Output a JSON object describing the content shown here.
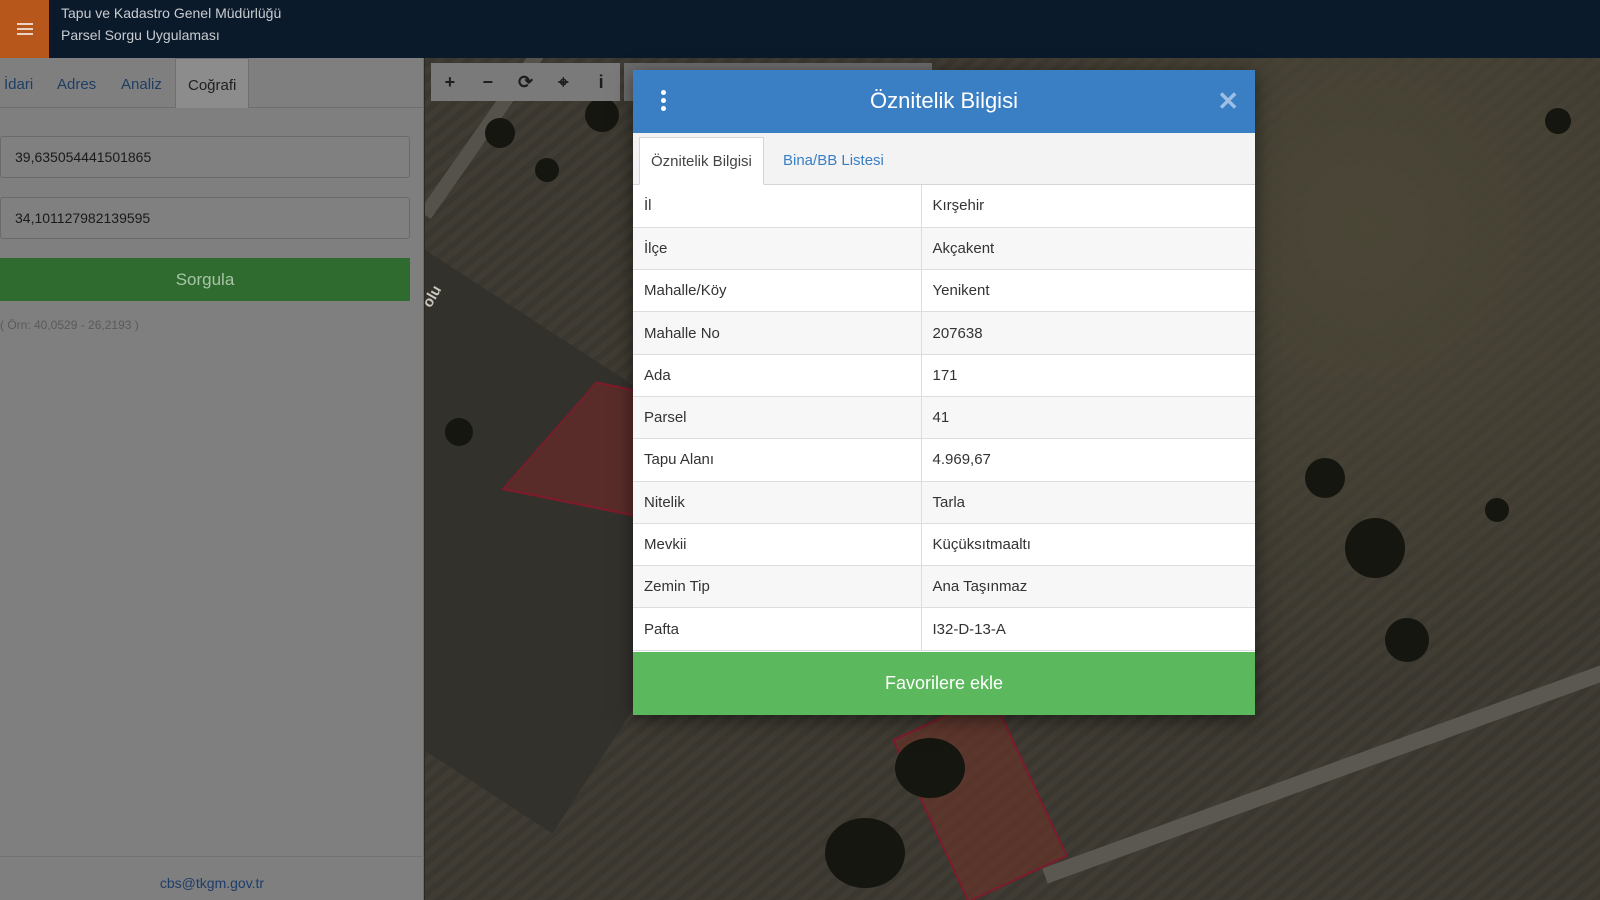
{
  "header": {
    "title_line1": "Tapu ve Kadastro Genel Müdürlüğü",
    "title_line2": "Parsel Sorgu Uygulaması"
  },
  "sidebar": {
    "tabs": [
      {
        "label": "İdari"
      },
      {
        "label": "Adres"
      },
      {
        "label": "Analiz"
      },
      {
        "label": "Coğrafi",
        "active": true
      }
    ],
    "latitude_value": "39,635054441501865",
    "longitude_value": "34,101127982139595",
    "query_button": "Sorgula",
    "hint": "( Örn: 40,0529 - 26,2193 )",
    "footer_email": "cbs@tkgm.gov.tr"
  },
  "map": {
    "road_label": "olu"
  },
  "toolbar": {
    "tools": [
      {
        "icon": "zoom-in-icon",
        "glyph": "+"
      },
      {
        "icon": "zoom-out-icon",
        "glyph": "−"
      },
      {
        "icon": "refresh-icon",
        "glyph": "⟳"
      },
      {
        "icon": "locate-icon",
        "glyph": "⌖"
      },
      {
        "icon": "info-icon",
        "glyph": "i"
      }
    ]
  },
  "modal": {
    "title": "Öznitelik Bilgisi",
    "close_glyph": "✕",
    "tabs": [
      {
        "label": "Öznitelik Bilgisi",
        "active": true
      },
      {
        "label": "Bina/BB Listesi",
        "active": false
      }
    ],
    "rows": [
      {
        "key": "İl",
        "value": "Kırşehir"
      },
      {
        "key": "İlçe",
        "value": "Akçakent"
      },
      {
        "key": "Mahalle/Köy",
        "value": "Yenikent"
      },
      {
        "key": "Mahalle No",
        "value": "207638"
      },
      {
        "key": "Ada",
        "value": "171"
      },
      {
        "key": "Parsel",
        "value": "41"
      },
      {
        "key": "Tapu Alanı",
        "value": "4.969,67"
      },
      {
        "key": "Nitelik",
        "value": "Tarla"
      },
      {
        "key": "Mevkii",
        "value": "Küçüksıtmaaltı"
      },
      {
        "key": "Zemin Tip",
        "value": "Ana Taşınmaz"
      },
      {
        "key": "Pafta",
        "value": "I32-D-13-A"
      }
    ],
    "favorite_button": "Favorilere ekle"
  },
  "colors": {
    "header_bg": "#0b1a2b",
    "menu_accent": "#b8571c",
    "modal_header": "#3a7fc4",
    "favorite_green": "#5cb85c",
    "query_green": "#2f6a2f"
  }
}
